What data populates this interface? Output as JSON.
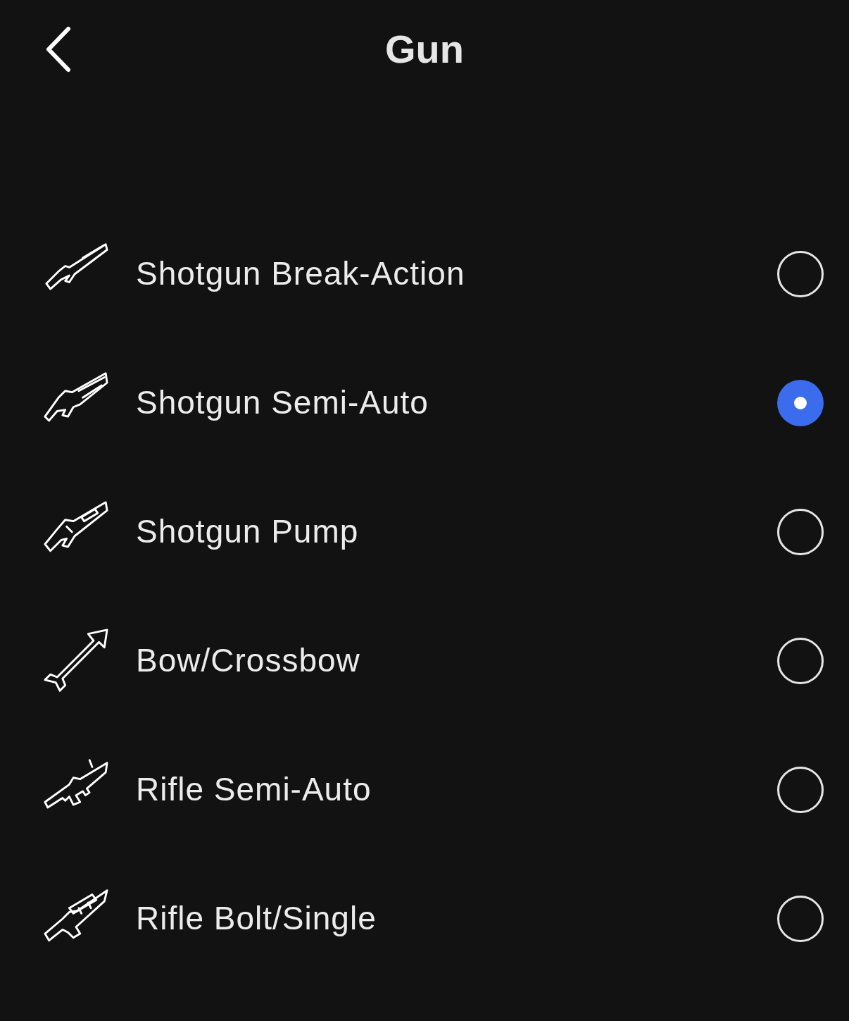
{
  "header": {
    "title": "Gun"
  },
  "options": [
    {
      "label": "Shotgun Break-Action",
      "selected": false
    },
    {
      "label": "Shotgun Semi-Auto",
      "selected": true
    },
    {
      "label": "Shotgun Pump",
      "selected": false
    },
    {
      "label": "Bow/Crossbow",
      "selected": false
    },
    {
      "label": "Rifle Semi-Auto",
      "selected": false
    },
    {
      "label": "Rifle Bolt/Single",
      "selected": false
    }
  ]
}
